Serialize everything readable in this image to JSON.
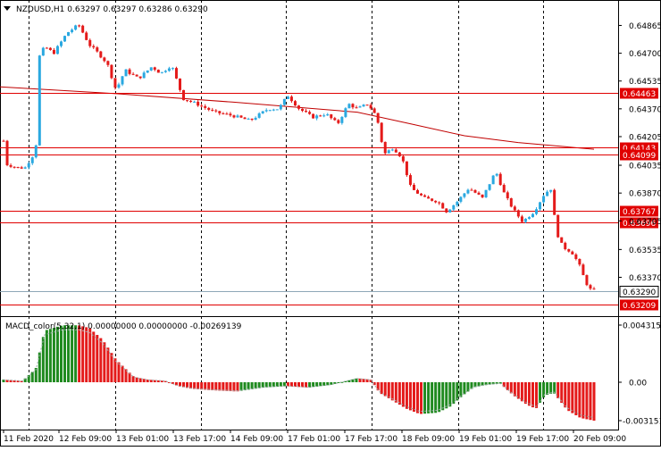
{
  "header": {
    "symbol_line": "NZDUSD,H1  0.63297 0.63297 0.63286 0.63290"
  },
  "macd": {
    "label": "MACD_color(5,32,1) 0.00000000 0.00000000 -0.00269139",
    "ticks": [
      "0.0043154",
      "0.00",
      "-0.003151"
    ]
  },
  "colors": {
    "up": "#2aa8e0",
    "down": "#e41a1a",
    "macd_pos": "#1f8a1f",
    "macd_neg": "#e41a1a",
    "hline": "#e00000",
    "ma": "#c00000",
    "grid": "#000000",
    "current": "#8fa8b8"
  },
  "chart_data": {
    "type": "candlestick",
    "symbol": "NZDUSD",
    "timeframe": "H1",
    "ylim": [
      0.6315,
      0.65
    ],
    "price_ticks": [
      "0.64865",
      "0.64700",
      "0.64535",
      "0.64370",
      "0.64205",
      "0.64035",
      "0.63870",
      "0.63705",
      "0.63535",
      "0.63370"
    ],
    "x_labels": [
      "11 Feb 2020",
      "12 Feb 09:00",
      "13 Feb 01:00",
      "13 Feb 17:00",
      "14 Feb 09:00",
      "17 Feb 01:00",
      "17 Feb 17:00",
      "18 Feb 09:00",
      "19 Feb 01:00",
      "19 Feb 17:00",
      "20 Feb 09:00"
    ],
    "vertical_separators": [
      32,
      129,
      225,
      320,
      416,
      513,
      608
    ],
    "levels": [
      {
        "label": "0.64463",
        "price": 0.64463
      },
      {
        "label": "0.64143",
        "price": 0.64143
      },
      {
        "label": "0.64099",
        "price": 0.64099
      },
      {
        "label": "0.63767",
        "price": 0.63767
      },
      {
        "label": "0.63696",
        "price": 0.63696
      },
      {
        "label": "0.63209",
        "price": 0.63209
      }
    ],
    "current_price": {
      "label": "0.63290",
      "price": 0.6329
    },
    "moving_average": [
      [
        0,
        0.645
      ],
      [
        130,
        0.6446
      ],
      [
        260,
        0.6441
      ],
      [
        400,
        0.6435
      ],
      [
        460,
        0.6428
      ],
      [
        520,
        0.6421
      ],
      [
        580,
        0.6417
      ],
      [
        665,
        0.6413
      ]
    ],
    "anchors": [
      [
        4,
        0.6418
      ],
      [
        8,
        0.6404
      ],
      [
        20,
        0.6402
      ],
      [
        28,
        0.6402
      ],
      [
        40,
        0.6412
      ],
      [
        44,
        0.6468
      ],
      [
        50,
        0.6474
      ],
      [
        60,
        0.647
      ],
      [
        75,
        0.6482
      ],
      [
        88,
        0.6487
      ],
      [
        100,
        0.6475
      ],
      [
        110,
        0.647
      ],
      [
        120,
        0.6464
      ],
      [
        130,
        0.6448
      ],
      [
        140,
        0.646
      ],
      [
        155,
        0.6455
      ],
      [
        170,
        0.6462
      ],
      [
        180,
        0.6458
      ],
      [
        192,
        0.6463
      ],
      [
        205,
        0.6443
      ],
      [
        220,
        0.644
      ],
      [
        240,
        0.6435
      ],
      [
        260,
        0.6433
      ],
      [
        280,
        0.643
      ],
      [
        300,
        0.6437
      ],
      [
        312,
        0.6437
      ],
      [
        322,
        0.6445
      ],
      [
        335,
        0.6437
      ],
      [
        350,
        0.6432
      ],
      [
        365,
        0.6434
      ],
      [
        378,
        0.6428
      ],
      [
        390,
        0.644
      ],
      [
        400,
        0.6437
      ],
      [
        412,
        0.644
      ],
      [
        422,
        0.6432
      ],
      [
        430,
        0.641
      ],
      [
        440,
        0.6414
      ],
      [
        450,
        0.6408
      ],
      [
        460,
        0.639
      ],
      [
        475,
        0.6384
      ],
      [
        490,
        0.6382
      ],
      [
        500,
        0.6376
      ],
      [
        512,
        0.6382
      ],
      [
        525,
        0.639
      ],
      [
        540,
        0.6384
      ],
      [
        555,
        0.64
      ],
      [
        565,
        0.6386
      ],
      [
        575,
        0.6377
      ],
      [
        585,
        0.637
      ],
      [
        598,
        0.6376
      ],
      [
        610,
        0.6387
      ],
      [
        618,
        0.639
      ],
      [
        622,
        0.6365
      ],
      [
        630,
        0.6355
      ],
      [
        640,
        0.6352
      ],
      [
        648,
        0.6345
      ],
      [
        655,
        0.6335
      ],
      [
        660,
        0.633
      ],
      [
        665,
        0.6329
      ]
    ],
    "macd_anchors": [
      [
        4,
        0.0002
      ],
      [
        25,
        0.0001
      ],
      [
        40,
        0.001
      ],
      [
        50,
        0.0039
      ],
      [
        70,
        0.0043
      ],
      [
        88,
        0.0043
      ],
      [
        100,
        0.0041
      ],
      [
        115,
        0.0032
      ],
      [
        130,
        0.0017
      ],
      [
        150,
        0.0004
      ],
      [
        165,
        0.0002
      ],
      [
        185,
        0.0001
      ],
      [
        200,
        -0.0003
      ],
      [
        215,
        -0.0005
      ],
      [
        235,
        -0.0006
      ],
      [
        265,
        -0.0007
      ],
      [
        295,
        -0.0004
      ],
      [
        320,
        -0.0003
      ],
      [
        345,
        -0.0004
      ],
      [
        370,
        -0.0002
      ],
      [
        400,
        0.0003
      ],
      [
        415,
        0.0002
      ],
      [
        425,
        -0.0008
      ],
      [
        440,
        -0.0014
      ],
      [
        455,
        -0.002
      ],
      [
        470,
        -0.0024
      ],
      [
        490,
        -0.0023
      ],
      [
        505,
        -0.0018
      ],
      [
        518,
        -0.001
      ],
      [
        530,
        -0.0004
      ],
      [
        545,
        -0.0002
      ],
      [
        560,
        -0.0001
      ],
      [
        575,
        -0.001
      ],
      [
        590,
        -0.0017
      ],
      [
        600,
        -0.002
      ],
      [
        610,
        -0.001
      ],
      [
        620,
        -0.0008
      ],
      [
        635,
        -0.0021
      ],
      [
        650,
        -0.0027
      ],
      [
        665,
        -0.0029
      ]
    ],
    "macd_ylim": [
      -0.00315,
      0.0043154
    ],
    "bars": 165
  }
}
